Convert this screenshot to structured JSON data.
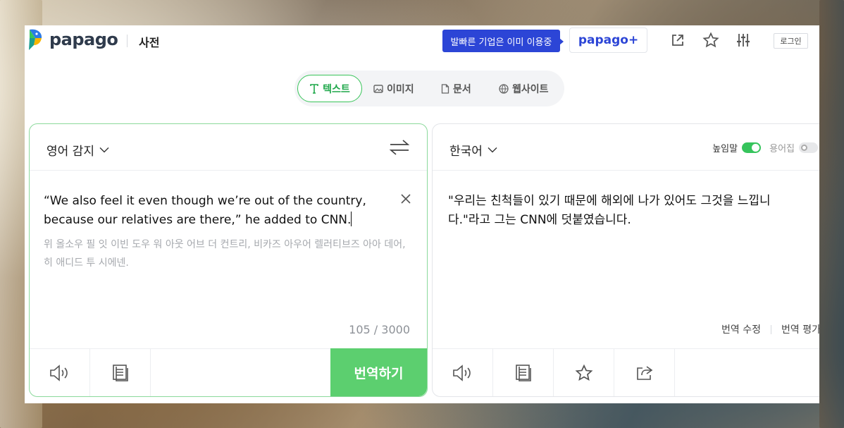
{
  "header": {
    "logo_text": "papago",
    "dict_label": "사전",
    "promo_text": "발빠른 기업은 이미 이용중",
    "plus_label": "papago+",
    "login_label": "로그인"
  },
  "tabs": [
    {
      "label": "텍스트",
      "icon": "text-icon",
      "active": true
    },
    {
      "label": "이미지",
      "icon": "image-icon",
      "active": false
    },
    {
      "label": "문서",
      "icon": "document-icon",
      "active": false
    },
    {
      "label": "웹사이트",
      "icon": "globe-icon",
      "active": false
    }
  ],
  "source": {
    "language": "영어 감지",
    "text_line1": "“We also feel it even though we’re out of the country,",
    "text_line2": "because our relatives are there,” he added to CNN.",
    "pronunciation": "위 올소우 필 잇 이빈 도우 워 아웃 어브 더 컨트리, 비카즈 아우어 렐러티브즈 아아 데어, 히 애디드 투 시에넨.",
    "char_count": "105 / 3000",
    "translate_button": "번역하기"
  },
  "target": {
    "language": "한국어",
    "honorific_label": "높임말",
    "honorific_on": true,
    "glossary_label": "용어집",
    "glossary_on": false,
    "text": "\"우리는 친척들이 있기 때문에 해외에 나가 있어도 그것을 느낍니다.\"라고 그는 CNN에 덧붙였습니다.",
    "edit_link": "번역 수정",
    "rate_link": "번역 평가"
  },
  "colors": {
    "accent_green": "#5ccf6f",
    "brand_blue": "#2c45d6"
  }
}
